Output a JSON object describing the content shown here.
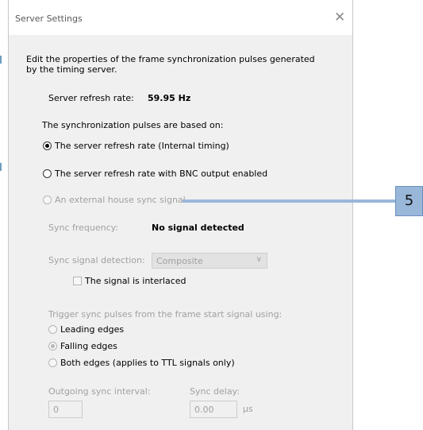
{
  "dialog": {
    "title": "Server Settings",
    "close_glyph": "✕",
    "description": "Edit the properties of the frame synchronization pulses generated by the timing server.",
    "refresh_rate_label": "Server refresh rate:",
    "refresh_rate_value": "59.95 Hz",
    "based_on_label": "The synchronization pulses are based on:",
    "radio_internal": "The server refresh rate (Internal timing)",
    "radio_bnc": "The server refresh rate with BNC output enabled",
    "radio_external": "An external house sync signal",
    "sync_frequency_label": "Sync frequency:",
    "sync_frequency_value": "No signal detected",
    "sync_detection_label": "Sync signal detection:",
    "sync_detection_value": "Composite",
    "interlaced_label": "The signal is interlaced",
    "trigger_label": "Trigger sync pulses from the frame start signal using:",
    "radio_leading": "Leading edges",
    "radio_falling": "Falling edges",
    "radio_both": "Both edges (applies to TTL signals only)",
    "outgoing_interval_label": "Outgoing sync interval:",
    "outgoing_interval_value": "0",
    "sync_delay_label": "Sync delay:",
    "sync_delay_value": "0.00",
    "sync_delay_unit": "µs"
  },
  "callout": {
    "number": "5",
    "color": "#99b7d9"
  }
}
